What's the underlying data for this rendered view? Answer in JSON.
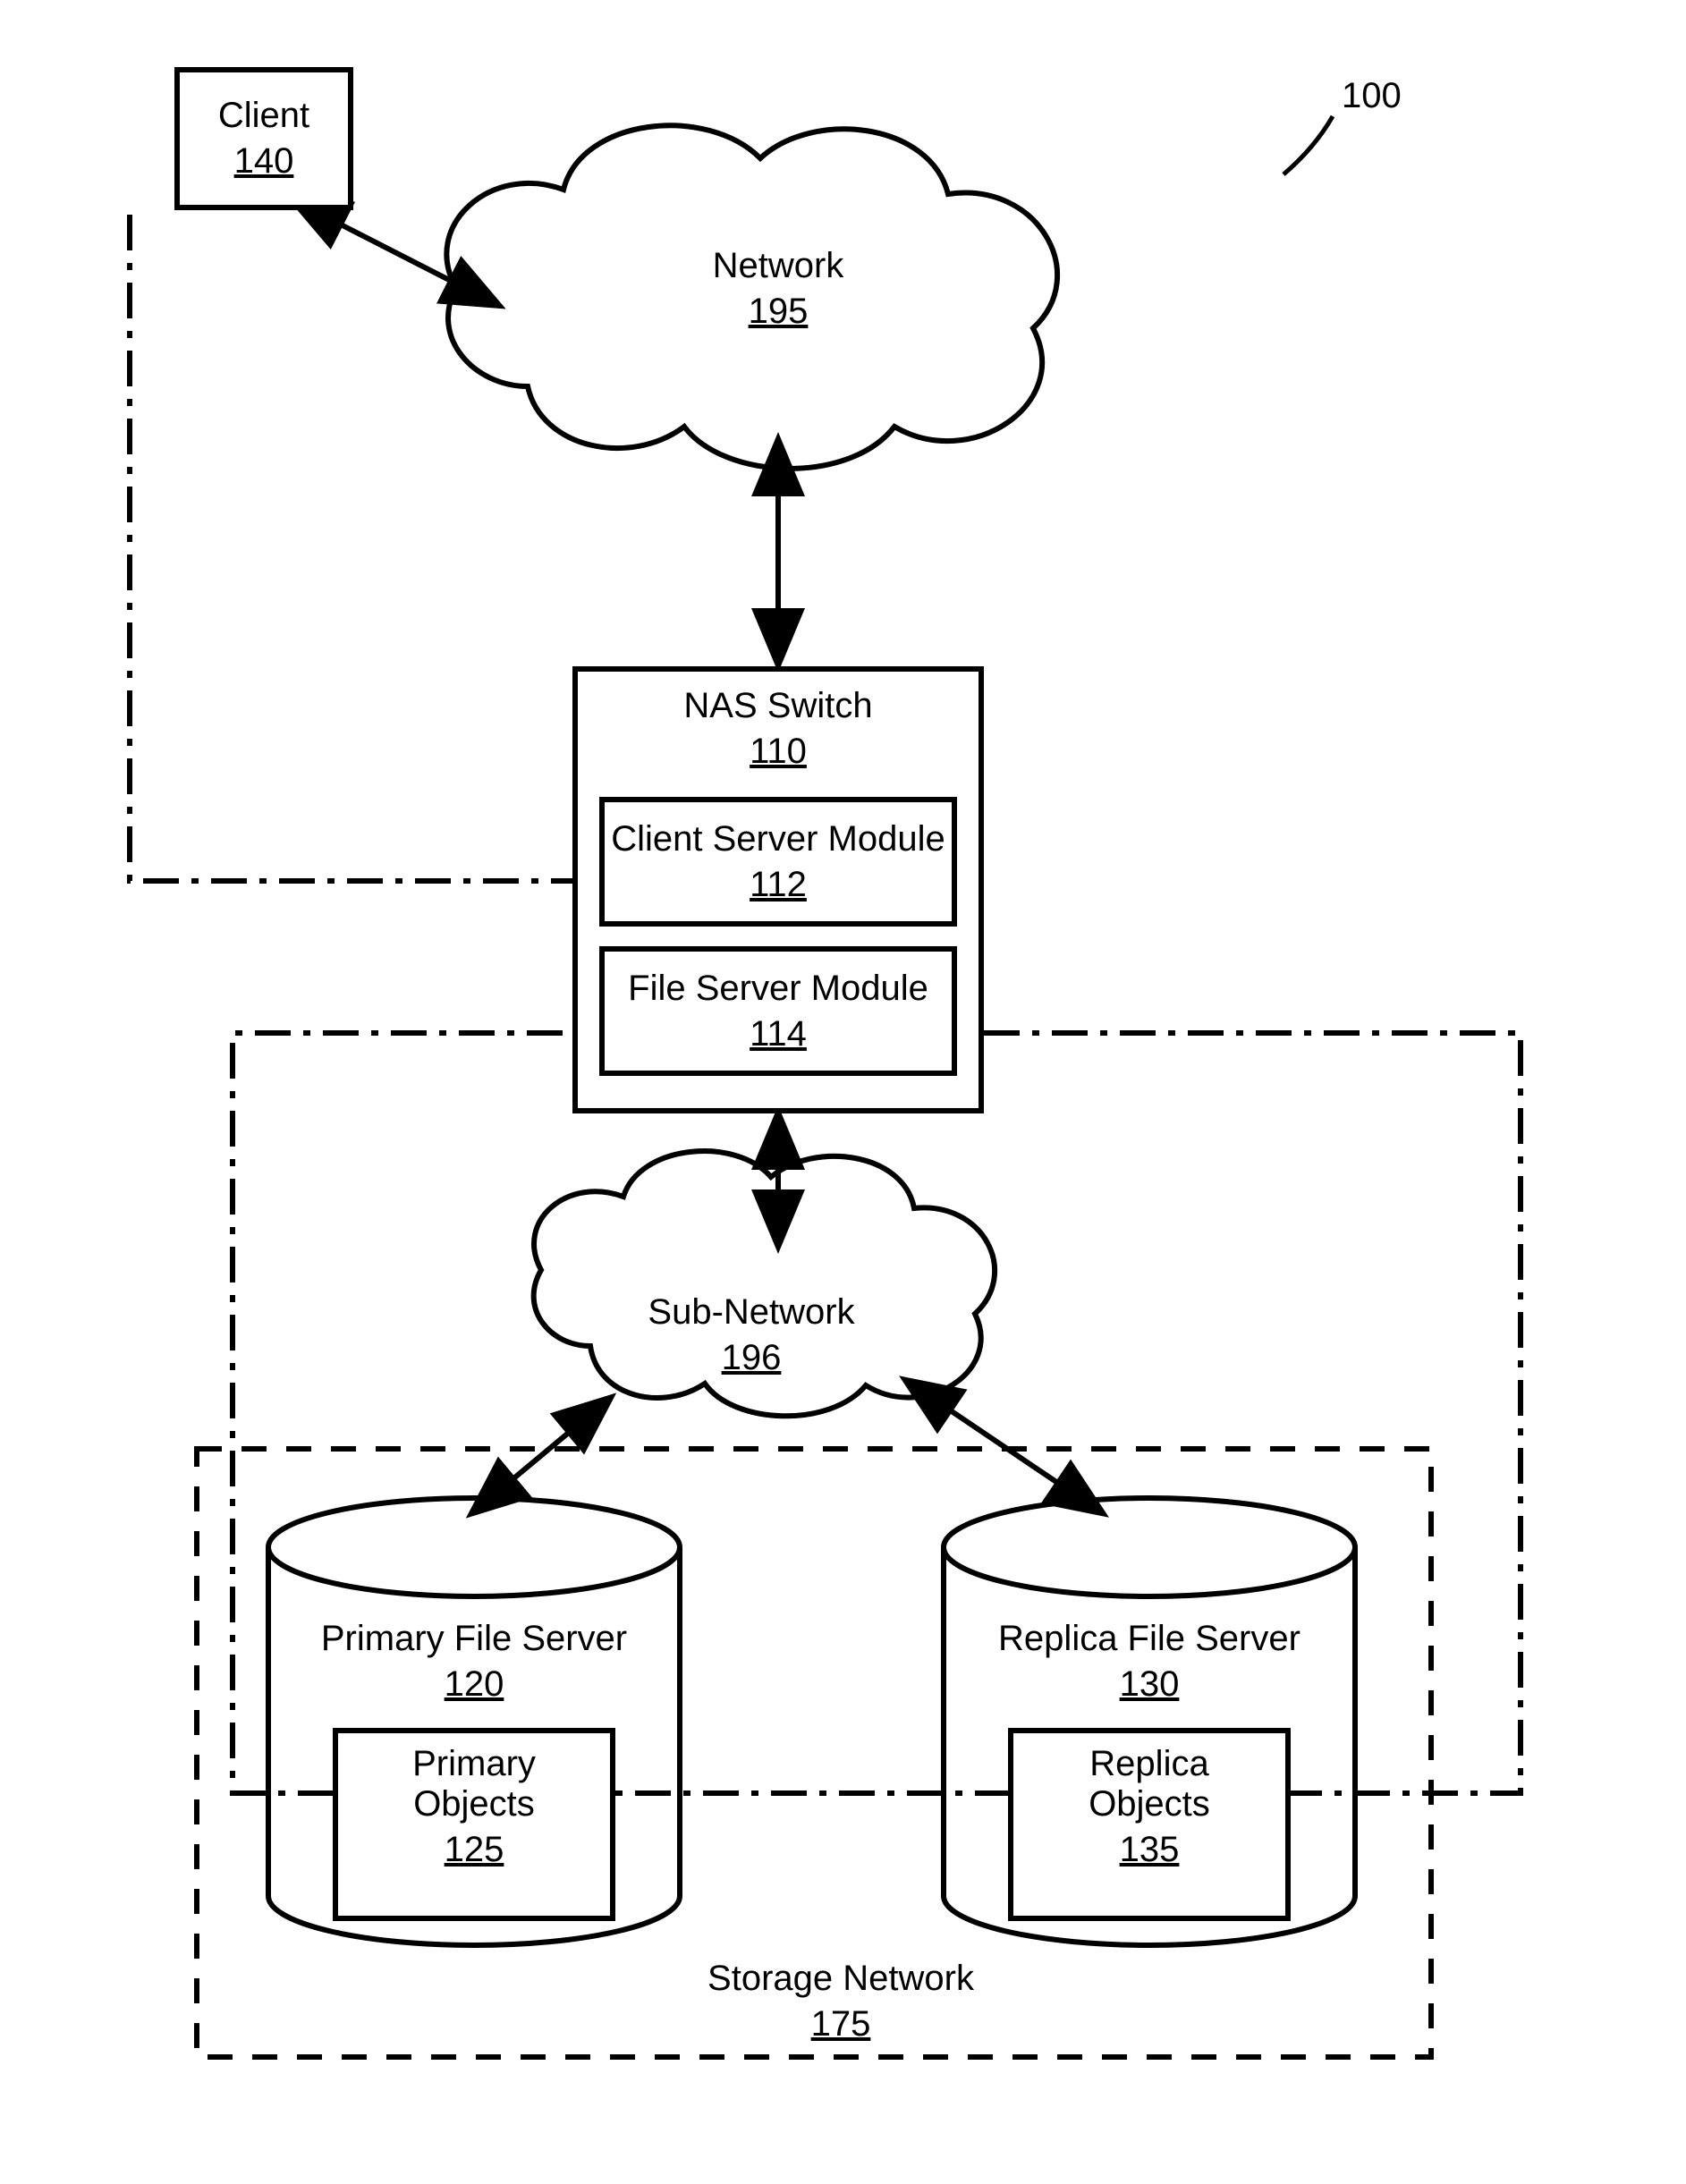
{
  "figureRef": "100",
  "client": {
    "label": "Client",
    "ref": "140"
  },
  "network": {
    "label": "Network",
    "ref": "195"
  },
  "nasSwitch": {
    "label": "NAS Switch",
    "ref": "110",
    "clientServerModule": {
      "label": "Client Server Module",
      "ref": "112"
    },
    "fileServerModule": {
      "label": "File Server Module",
      "ref": "114"
    }
  },
  "subNetwork": {
    "label": "Sub-Network",
    "ref": "196"
  },
  "primaryFileServer": {
    "label": "Primary File Server",
    "ref": "120",
    "objects": {
      "label": "Primary\nObjects",
      "ref": "125"
    }
  },
  "replicaFileServer": {
    "label": "Replica File Server",
    "ref": "130",
    "objects": {
      "label": "Replica\nObjects",
      "ref": "135"
    }
  },
  "storageNetwork": {
    "label": "Storage Network",
    "ref": "175"
  }
}
